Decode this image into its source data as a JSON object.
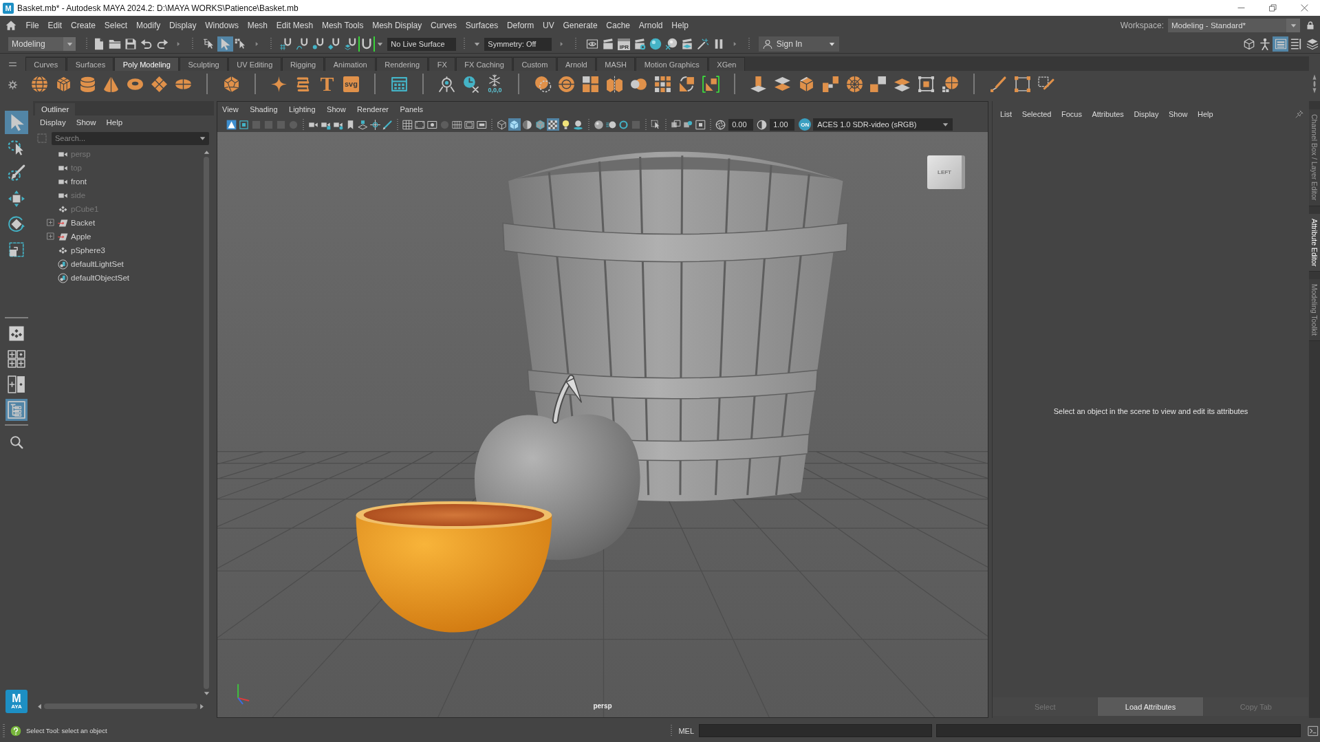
{
  "window": {
    "logo": "M",
    "title": "Basket.mb* - Autodesk MAYA 2024.2: D:\\MAYA WORKS\\Patience\\Basket.mb"
  },
  "menu_bar": {
    "items": [
      "File",
      "Edit",
      "Create",
      "Select",
      "Modify",
      "Display",
      "Windows",
      "Mesh",
      "Edit Mesh",
      "Mesh Tools",
      "Mesh Display",
      "Curves",
      "Surfaces",
      "Deform",
      "UV",
      "Generate",
      "Cache",
      "Arnold",
      "Help"
    ],
    "workspace_label": "Workspace:",
    "workspace": "Modeling - Standard*"
  },
  "status_line": {
    "menu_set": "Modeling",
    "select_modes": [
      {
        "kind": "hierarchy",
        "selected": false
      },
      {
        "kind": "object",
        "selected": true
      },
      {
        "kind": "component",
        "selected": false
      }
    ],
    "snaps": [
      {
        "kind": "grid",
        "on": false
      },
      {
        "kind": "curve",
        "on": false
      },
      {
        "kind": "point",
        "on": false
      },
      {
        "kind": "view_plane",
        "on": false
      },
      {
        "kind": "surface",
        "on": false
      },
      {
        "kind": "live",
        "on": true
      }
    ],
    "live_surface": "No Live Surface",
    "symmetry": "Symmetry: Off",
    "ipr": "IPR",
    "sign_in": "Sign In",
    "panel_toggles": [
      {
        "kind": "modeling_toolkit",
        "selected": false
      },
      {
        "kind": "character_controls",
        "selected": false
      },
      {
        "kind": "attribute_editor",
        "selected": true
      },
      {
        "kind": "tool_settings",
        "selected": false
      },
      {
        "kind": "channel_box",
        "selected": false
      }
    ]
  },
  "shelf": {
    "tabs": [
      {
        "label": "Curves",
        "selected": false
      },
      {
        "label": "Surfaces",
        "selected": false
      },
      {
        "label": "Poly Modeling",
        "selected": true
      },
      {
        "label": "Sculpting",
        "selected": false
      },
      {
        "label": "UV Editing",
        "selected": false
      },
      {
        "label": "Rigging",
        "selected": false
      },
      {
        "label": "Animation",
        "selected": false
      },
      {
        "label": "Rendering",
        "selected": false
      },
      {
        "label": "FX",
        "selected": false
      },
      {
        "label": "FX Caching",
        "selected": false
      },
      {
        "label": "Custom",
        "selected": false
      },
      {
        "label": "Arnold",
        "selected": false
      },
      {
        "label": "MASH",
        "selected": false
      },
      {
        "label": "Motion Graphics",
        "selected": false
      },
      {
        "label": "XGen",
        "selected": false
      }
    ],
    "text_tool": "T",
    "svg_tool": "svg",
    "freeze_values": "0,0,0"
  },
  "toolbox": {
    "tools": [
      {
        "kind": "select",
        "selected": true
      },
      {
        "kind": "lasso",
        "selected": false
      },
      {
        "kind": "paint",
        "selected": false
      },
      {
        "kind": "move",
        "selected": false
      },
      {
        "kind": "rotate",
        "selected": false
      },
      {
        "kind": "scale",
        "selected": false
      }
    ],
    "layouts": [
      {
        "kind": "single",
        "selected": false
      },
      {
        "kind": "four",
        "selected": false
      },
      {
        "kind": "two",
        "selected": false
      },
      {
        "kind": "outliner",
        "selected": true
      }
    ],
    "logo": "M",
    "logo_sub": "AYA"
  },
  "outliner": {
    "title": "Outliner",
    "menu": [
      "Display",
      "Show",
      "Help"
    ],
    "search": {
      "placeholder": "Search..."
    },
    "items": [
      {
        "label": "persp",
        "kind": "camera",
        "dimmed": true
      },
      {
        "label": "top",
        "kind": "camera",
        "dimmed": true
      },
      {
        "label": "front",
        "kind": "camera",
        "dimmed": false
      },
      {
        "label": "side",
        "kind": "camera",
        "dimmed": true
      },
      {
        "label": "pCube1",
        "kind": "mesh",
        "dimmed": true
      },
      {
        "label": "Backet",
        "kind": "group",
        "dimmed": false,
        "expanded": false
      },
      {
        "label": "Apple",
        "kind": "group",
        "dimmed": false,
        "expanded": false
      },
      {
        "label": "pSphere3",
        "kind": "mesh",
        "dimmed": false
      },
      {
        "label": "defaultLightSet",
        "kind": "set",
        "dimmed": false
      },
      {
        "label": "defaultObjectSet",
        "kind": "set",
        "dimmed": false
      }
    ]
  },
  "viewport": {
    "menu": [
      "View",
      "Shading",
      "Lighting",
      "Show",
      "Renderer",
      "Panels"
    ],
    "shading": [
      {
        "kind": "wireframe",
        "on": false
      },
      {
        "kind": "smooth_shade",
        "on": true
      },
      {
        "kind": "default_material",
        "on": false
      },
      {
        "kind": "wireframe_on_shaded",
        "on": false
      },
      {
        "kind": "textured",
        "on": true
      },
      {
        "kind": "lights",
        "on": false
      },
      {
        "kind": "shadows",
        "on": false
      }
    ],
    "exposure": "0.00",
    "gamma": "1.00",
    "color_management": "ON",
    "color_space": "ACES 1.0 SDR-video (sRGB)",
    "view_cube": "LEFT",
    "camera": "persp"
  },
  "attribute_editor": {
    "menu": [
      "List",
      "Selected",
      "Focus",
      "Attributes",
      "Display",
      "Show",
      "Help"
    ],
    "message": "Select an object in the scene to view and edit its attributes",
    "buttons": [
      {
        "label": "Select",
        "disabled": true
      },
      {
        "label": "Load Attributes",
        "disabled": false
      },
      {
        "label": "Copy Tab",
        "disabled": true
      }
    ]
  },
  "side_tabs": [
    {
      "label": "Channel Box / Layer Editor",
      "selected": false
    },
    {
      "label": "Attribute Editor",
      "selected": true
    },
    {
      "label": "Modeling Toolkit",
      "selected": false
    }
  ],
  "help_line": "Select Tool: select an object",
  "command_line": {
    "language": "MEL"
  }
}
